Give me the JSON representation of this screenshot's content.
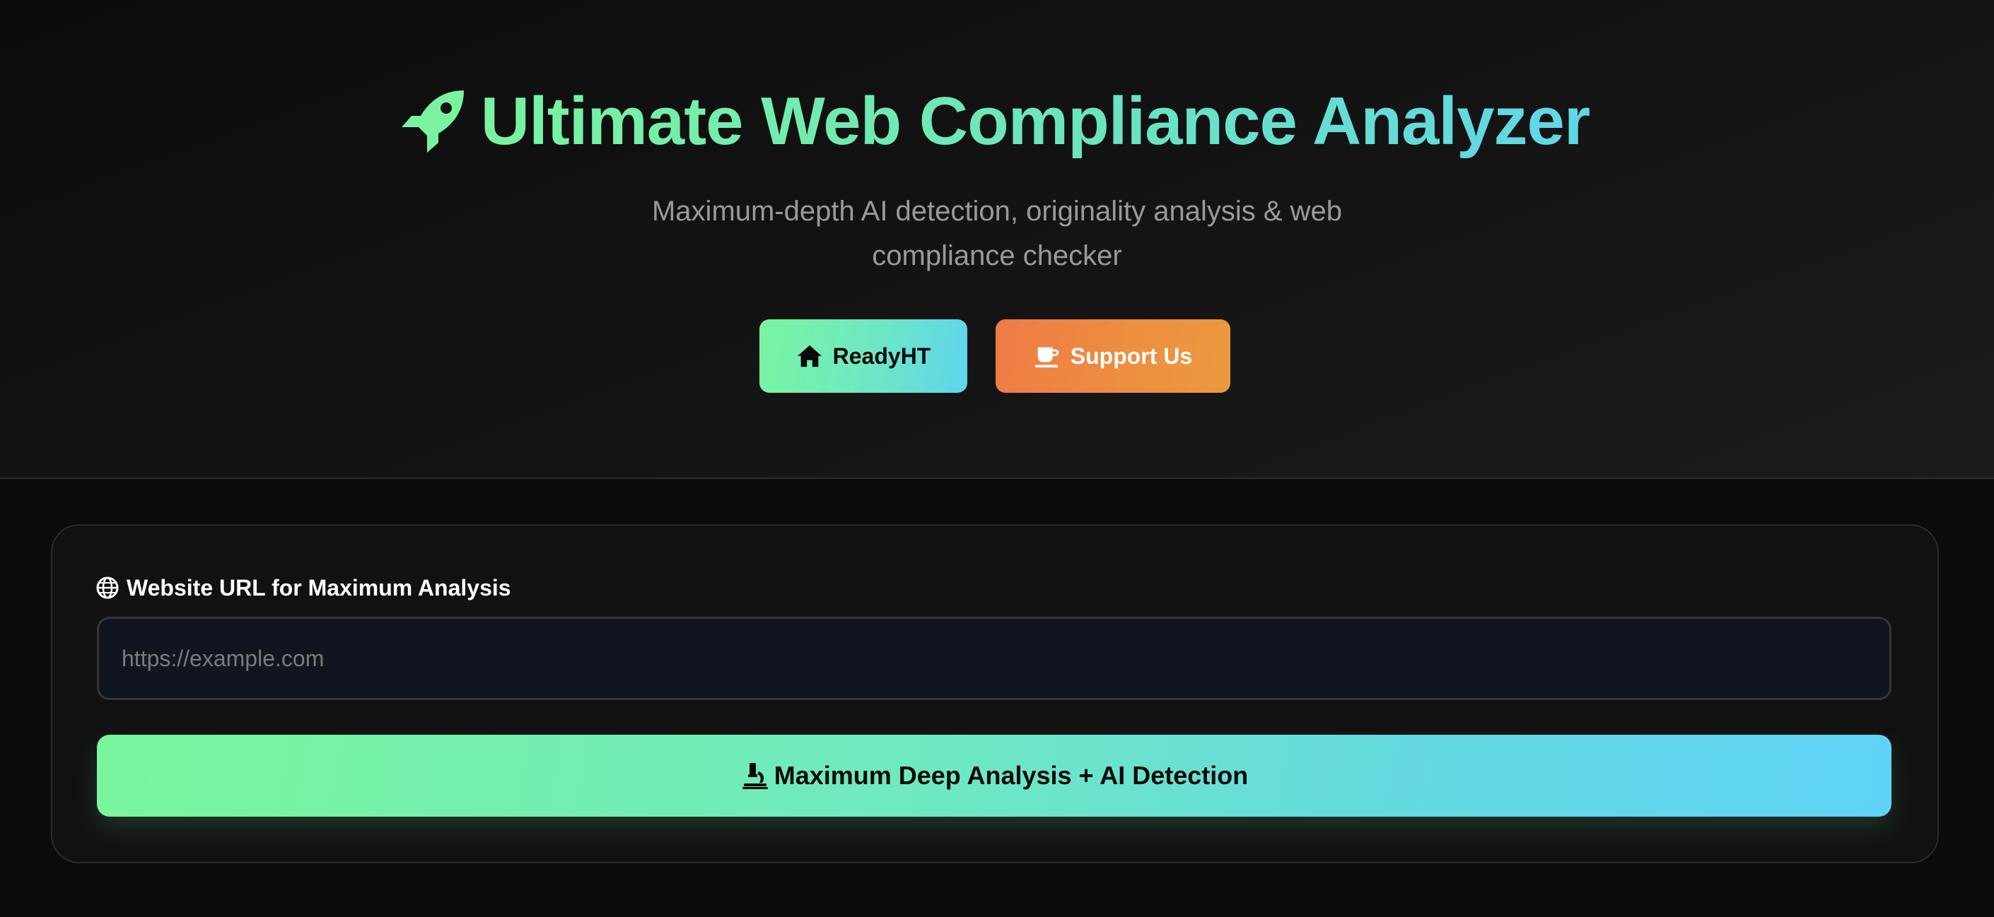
{
  "header": {
    "title": "Ultimate Web Compliance Analyzer",
    "title_icon": "rocket-icon",
    "subtitle_line1": "Maximum-depth AI detection, originality analysis & web",
    "subtitle_line2": "compliance checker",
    "buttons": [
      {
        "label": "ReadyHT",
        "icon": "home-icon"
      },
      {
        "label": "Support Us",
        "icon": "coffee-icon"
      }
    ]
  },
  "form": {
    "label": "Website URL for Maximum Analysis",
    "label_icon": "globe-icon",
    "url_value": "",
    "url_placeholder": "https://example.com",
    "submit_label": "Maximum Deep Analysis + AI Detection",
    "submit_icon": "microscope-icon"
  },
  "colors": {
    "background": "#0b0b0b",
    "accent_green": "#79f3a0",
    "accent_cyan": "#5fd3f6",
    "support_orange": "#ee7b46",
    "subtitle_gray": "#9a9a9a"
  }
}
